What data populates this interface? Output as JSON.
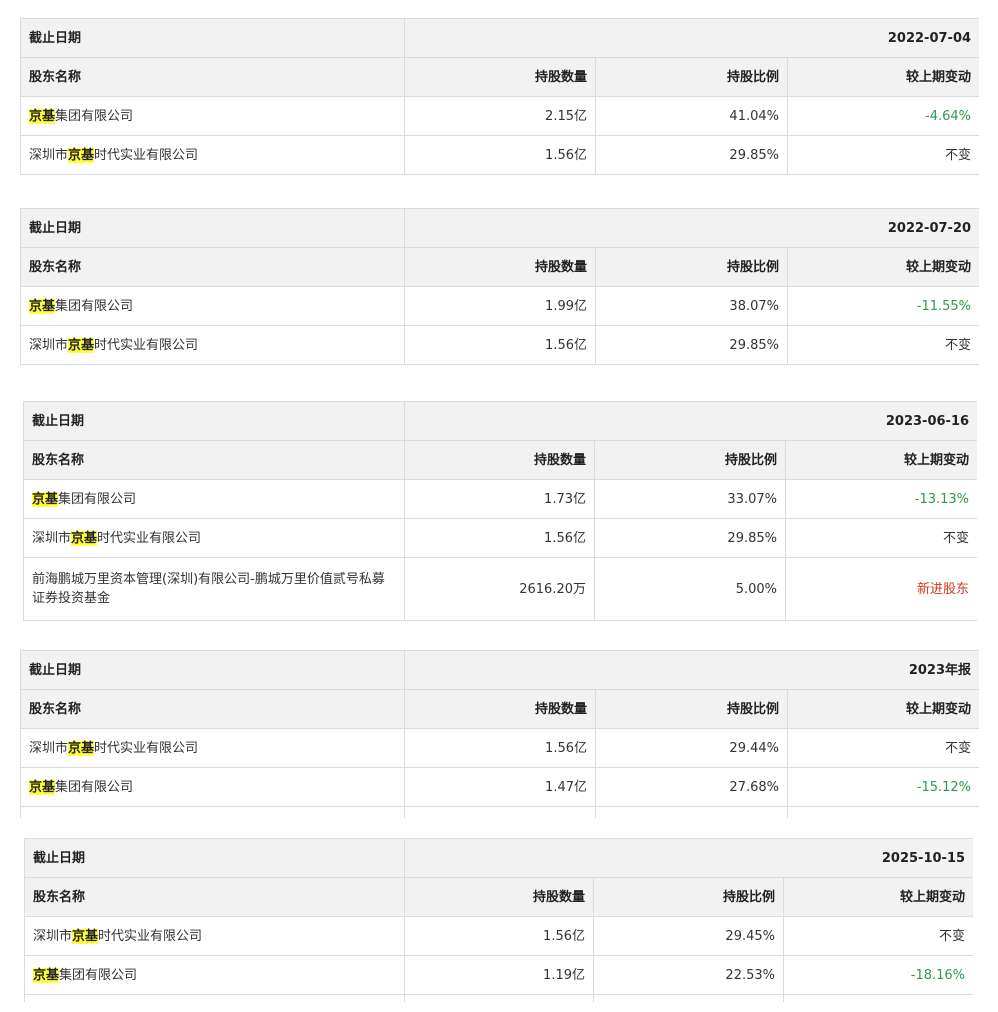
{
  "tables": [
    {
      "date_label": "截止日期",
      "date_value": "2022-07-04",
      "headers": [
        "股东名称",
        "持股数量",
        "持股比例",
        "较上期变动"
      ],
      "rows": [
        {
          "pre": "",
          "hl": "京基",
          "post": "集团有限公司",
          "shares": "2.15亿",
          "ratio": "41.04%",
          "change": "-4.64%",
          "change_type": "neg"
        },
        {
          "pre": "深圳市",
          "hl": "京基",
          "post": "时代实业有限公司",
          "shares": "1.56亿",
          "ratio": "29.85%",
          "change": "不变",
          "change_type": "same"
        }
      ]
    },
    {
      "date_label": "截止日期",
      "date_value": "2022-07-20",
      "headers": [
        "股东名称",
        "持股数量",
        "持股比例",
        "较上期变动"
      ],
      "rows": [
        {
          "pre": "",
          "hl": "京基",
          "post": "集团有限公司",
          "shares": "1.99亿",
          "ratio": "38.07%",
          "change": "-11.55%",
          "change_type": "neg"
        },
        {
          "pre": "深圳市",
          "hl": "京基",
          "post": "时代实业有限公司",
          "shares": "1.56亿",
          "ratio": "29.85%",
          "change": "不变",
          "change_type": "same"
        }
      ]
    },
    {
      "date_label": "截止日期",
      "date_value": "2023-06-16",
      "headers": [
        "股东名称",
        "持股数量",
        "持股比例",
        "较上期变动"
      ],
      "rows": [
        {
          "pre": "",
          "hl": "京基",
          "post": "集团有限公司",
          "shares": "1.73亿",
          "ratio": "33.07%",
          "change": "-13.13%",
          "change_type": "neg"
        },
        {
          "pre": "深圳市",
          "hl": "京基",
          "post": "时代实业有限公司",
          "shares": "1.56亿",
          "ratio": "29.85%",
          "change": "不变",
          "change_type": "same"
        },
        {
          "pre": "前海鹏城万里资本管理(深圳)有限公司-鹏城万里价值贰号私募证券投资基金",
          "hl": "",
          "post": "",
          "shares": "2616.20万",
          "ratio": "5.00%",
          "change": "新进股东",
          "change_type": "new"
        }
      ]
    },
    {
      "date_label": "截止日期",
      "date_value": "2023年报",
      "headers": [
        "股东名称",
        "持股数量",
        "持股比例",
        "较上期变动"
      ],
      "rows": [
        {
          "pre": "深圳市",
          "hl": "京基",
          "post": "时代实业有限公司",
          "shares": "1.56亿",
          "ratio": "29.44%",
          "change": "不变",
          "change_type": "same"
        },
        {
          "pre": "",
          "hl": "京基",
          "post": "集团有限公司",
          "shares": "1.47亿",
          "ratio": "27.68%",
          "change": "-15.12%",
          "change_type": "neg"
        }
      ]
    },
    {
      "date_label": "截止日期",
      "date_value": "2025-10-15",
      "headers": [
        "股东名称",
        "持股数量",
        "持股比例",
        "较上期变动"
      ],
      "rows": [
        {
          "pre": "深圳市",
          "hl": "京基",
          "post": "时代实业有限公司",
          "shares": "1.56亿",
          "ratio": "29.45%",
          "change": "不变",
          "change_type": "same"
        },
        {
          "pre": "",
          "hl": "京基",
          "post": "集团有限公司",
          "shares": "1.19亿",
          "ratio": "22.53%",
          "change": "-18.16%",
          "change_type": "neg"
        }
      ]
    }
  ],
  "colors": {
    "header_bg": "#f2f2f2",
    "border": "#dcdcdc",
    "highlight": "#ffff3c",
    "negative": "#2e9a4a",
    "new_holder": "#d0391b"
  }
}
